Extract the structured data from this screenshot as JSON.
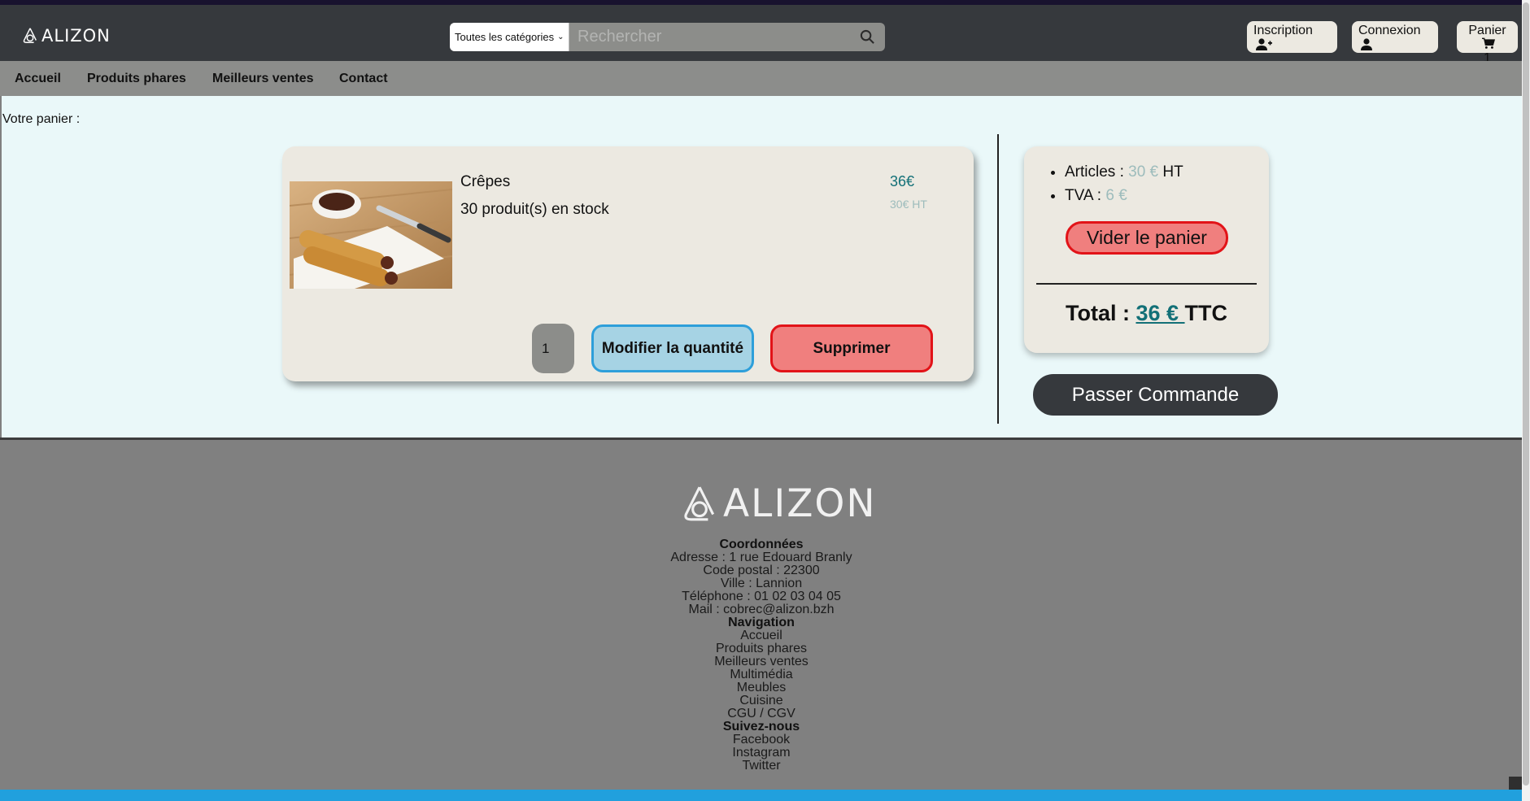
{
  "header": {
    "logo_text": "ALIZON",
    "search": {
      "category": "Toutes les catégories",
      "placeholder": "Rechercher"
    },
    "buttons": {
      "inscription": "Inscription",
      "connexion": "Connexion",
      "panier": "Panier",
      "panier_count": "1"
    }
  },
  "nav": {
    "items": [
      "Accueil",
      "Produits phares",
      "Meilleurs ventes",
      "Contact"
    ]
  },
  "cart": {
    "heading": "Votre panier :",
    "item": {
      "name": "Crêpes",
      "stock": "30 produit(s) en stock",
      "price": "36€",
      "price_ht": "30€ HT",
      "quantity": "1",
      "modify_label": "Modifier la quantité",
      "delete_label": "Supprimer"
    },
    "summary": {
      "articles_label": "Articles : ",
      "articles_value": "30 €",
      "articles_suffix": " HT",
      "tva_label": "TVA : ",
      "tva_value": "6 €",
      "empty_label": "Vider le panier",
      "total_label": "Total : ",
      "total_value": "36 € ",
      "total_suffix": "TTC"
    },
    "checkout_label": "Passer Commande"
  },
  "footer": {
    "logo_text": "ALIZON",
    "coord_title": "Coordonnées",
    "address": "Adresse : 1 rue Edouard Branly",
    "postal": "Code postal : 22300",
    "city": "Ville : Lannion",
    "phone": "Téléphone : 01 02 03 04 05",
    "mail": "Mail : cobrec@alizon.bzh",
    "nav_title": "Navigation",
    "nav_links": [
      "Accueil",
      "Produits phares",
      "Meilleurs ventes",
      "Multimédia",
      "Meubles",
      "Cuisine",
      "CGU / CGV"
    ],
    "follow_title": "Suivez-nous",
    "social": [
      "Facebook",
      "Instagram",
      "Twitter"
    ]
  },
  "colors": {
    "header_bg": "#36393d",
    "nav_bg": "#8c8d8b",
    "main_bg": "#eaf8f9",
    "card_bg": "#ece9e1",
    "accent_teal": "#137077",
    "danger_red": "#e21318",
    "info_blue": "#2e9fda",
    "footer_bg": "#808080"
  },
  "icons": [
    "alizon-logo-icon",
    "search-icon",
    "user-plus-icon",
    "user-icon",
    "cart-icon",
    "chevron-down-icon"
  ]
}
